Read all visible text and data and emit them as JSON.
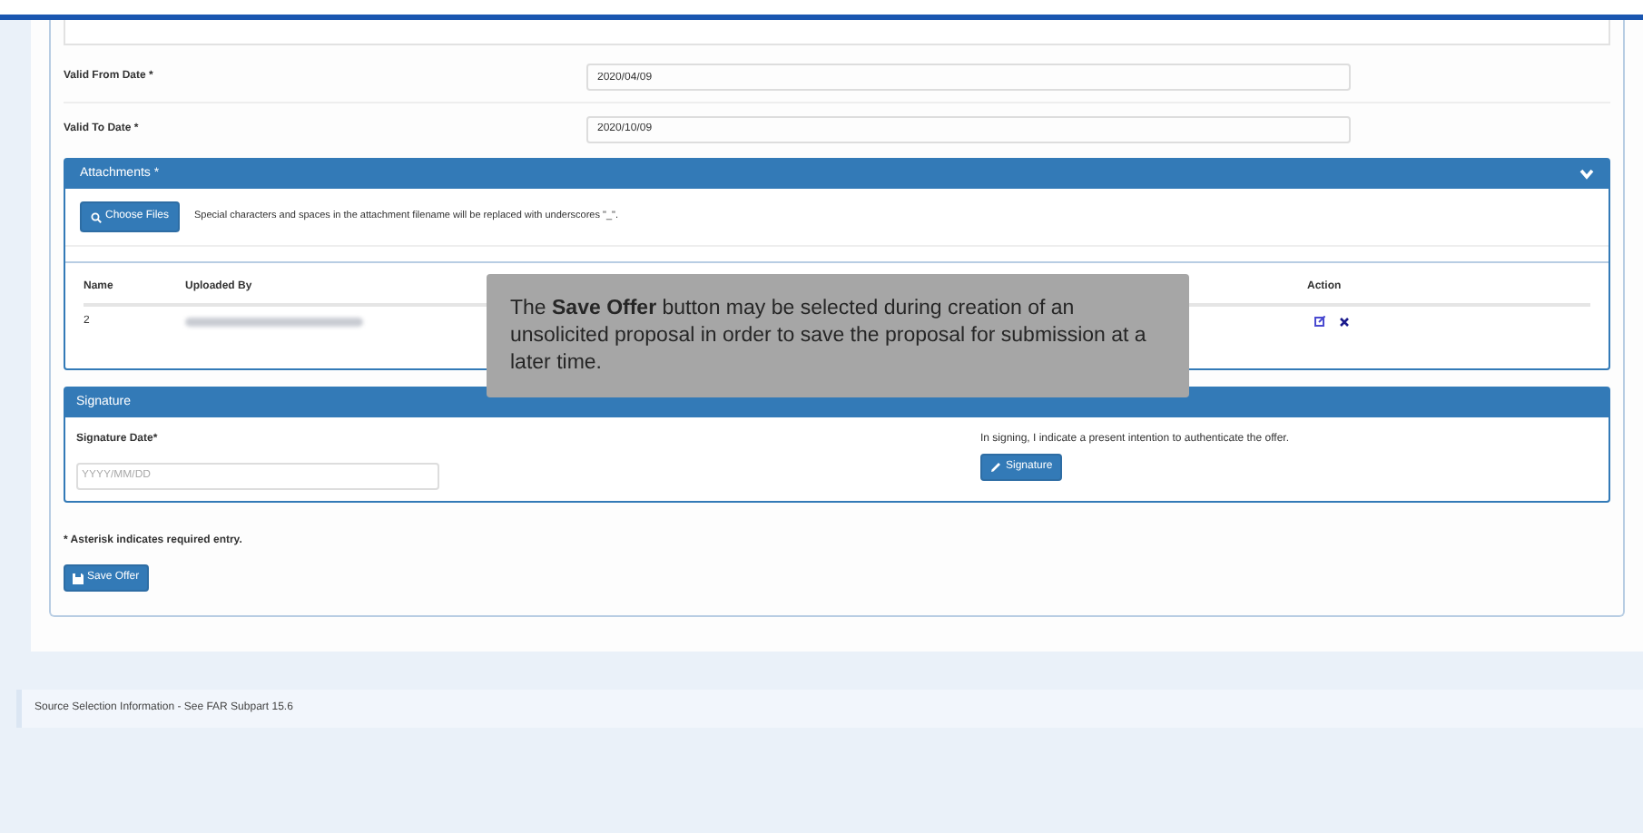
{
  "form": {
    "fields": [
      {
        "label": "Valid From Date *",
        "value": "2020/04/09"
      },
      {
        "label": "Valid To Date *",
        "value": "2020/10/09"
      }
    ]
  },
  "attachments": {
    "title": "Attachments *",
    "expanded": true,
    "choose_button": "Choose Files",
    "note": "Special characters and spaces in the attachment filename will be replaced with underscores \"_\".",
    "table": {
      "columns": [
        "Name",
        "Uploaded By",
        "Action"
      ],
      "rows": [
        {
          "name": "2",
          "uploaded_by": {
            "kind": "redacted"
          }
        }
      ]
    }
  },
  "tooltip": {
    "text": "The **Save Offer** button may be selected during creation of an unsolicited proposal in order to save the proposal for submission at a later time."
  },
  "signature": {
    "title": "Signature",
    "date_label": "Signature Date*",
    "date_placeholder": "YYYY/MM/DD",
    "statement": "In signing, I indicate a present intention to authenticate the offer.",
    "button": "Signature"
  },
  "required_note": "* Asterisk indicates required entry.",
  "save_button": "Save Offer",
  "footer": "Source Selection Information - See FAR Subpart 15.6"
}
